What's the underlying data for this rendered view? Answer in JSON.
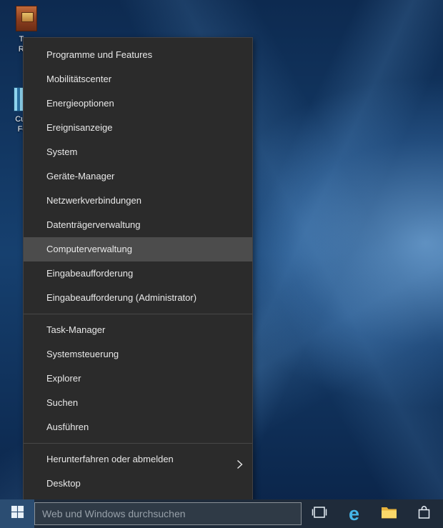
{
  "desktop": {
    "icons": [
      {
        "name": "tom-rainbow",
        "label_line1": "Tom",
        "label_line2": "Rain"
      },
      {
        "name": "cus-fe",
        "label_line1": "Cus",
        "label_line2": "Fe"
      }
    ]
  },
  "menu": {
    "items": [
      "Programme und Features",
      "Mobilitätscenter",
      "Energieoptionen",
      "Ereignisanzeige",
      "System",
      "Geräte-Manager",
      "Netzwerkverbindungen",
      "Datenträgerverwaltung",
      "Computerverwaltung",
      "Eingabeaufforderung",
      "Eingabeaufforderung (Administrator)",
      "Task-Manager",
      "Systemsteuerung",
      "Explorer",
      "Suchen",
      "Ausführen",
      "Herunterfahren oder abmelden",
      "Desktop"
    ],
    "highlighted_item": "Computerverwaltung",
    "submenu_item": "Herunterfahren oder abmelden"
  },
  "taskbar": {
    "search_placeholder": "Web und Windows durchsuchen",
    "icons": [
      "start",
      "task-view",
      "edge",
      "file-explorer",
      "store"
    ]
  },
  "colors": {
    "menu_bg": "#2b2b2b",
    "menu_highlight": "#4c4c4c",
    "menu_text": "#e8e8e8",
    "taskbar_bg": "#1f2b3a",
    "start_button_bg": "#2b4d72",
    "edge_blue": "#45b6e8",
    "folder_yellow": "#f3c84e",
    "wallpaper_base": "#16406f"
  }
}
